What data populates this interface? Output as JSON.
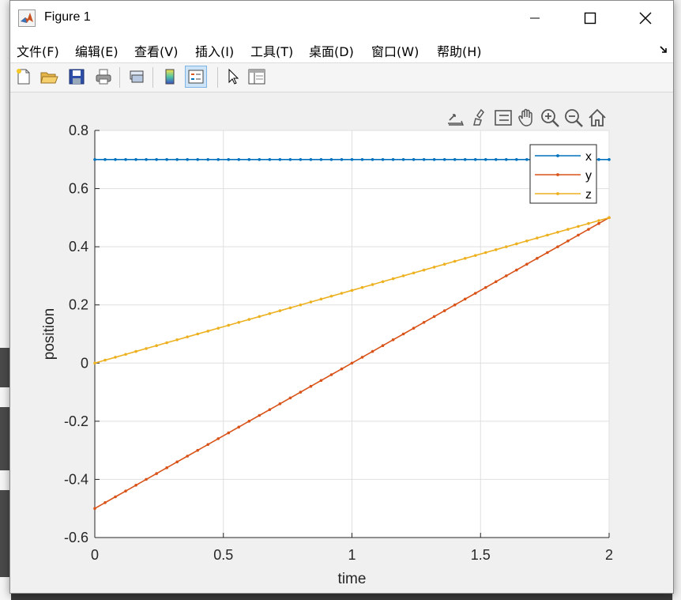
{
  "window": {
    "title": "Figure 1"
  },
  "menu": {
    "items": [
      "文件(F)",
      "编辑(E)",
      "查看(V)",
      "插入(I)",
      "工具(T)",
      "桌面(D)",
      "窗口(W)",
      "帮助(H)"
    ]
  },
  "toolbar": {
    "buttons": [
      "new-figure-icon",
      "open-file-icon",
      "save-icon",
      "print-icon",
      "link-plot-icon",
      "insert-colorbar-icon",
      "insert-legend-icon",
      "edit-plot-icon",
      "property-inspector-icon"
    ]
  },
  "axes_toolbar": {
    "buttons": [
      "export-icon",
      "brush-icon",
      "data-tips-icon",
      "pan-icon",
      "zoom-in-icon",
      "zoom-out-icon",
      "home-icon"
    ]
  },
  "colors": {
    "x": "#0072BD",
    "y": "#D95319",
    "z": "#EDB120"
  },
  "chart_data": {
    "type": "line",
    "title": "",
    "xlabel": "time",
    "ylabel": "position",
    "xlim": [
      0,
      2
    ],
    "ylim": [
      -0.6,
      0.8
    ],
    "xticks": [
      "0",
      "0.5",
      "1",
      "1.5",
      "2"
    ],
    "yticks": [
      "-0.6",
      "-0.4",
      "-0.2",
      "0",
      "0.2",
      "0.4",
      "0.6",
      "0.8"
    ],
    "grid": true,
    "legend_position": "top-right",
    "sampling": {
      "start": 0,
      "end": 2,
      "step": 0.04
    },
    "series": [
      {
        "name": "x",
        "marker": "point",
        "start": 0.7,
        "end": 0.7
      },
      {
        "name": "y",
        "marker": "point",
        "start": -0.5,
        "end": 0.5
      },
      {
        "name": "z",
        "marker": "point",
        "start": 0.0,
        "end": 0.5
      }
    ]
  }
}
